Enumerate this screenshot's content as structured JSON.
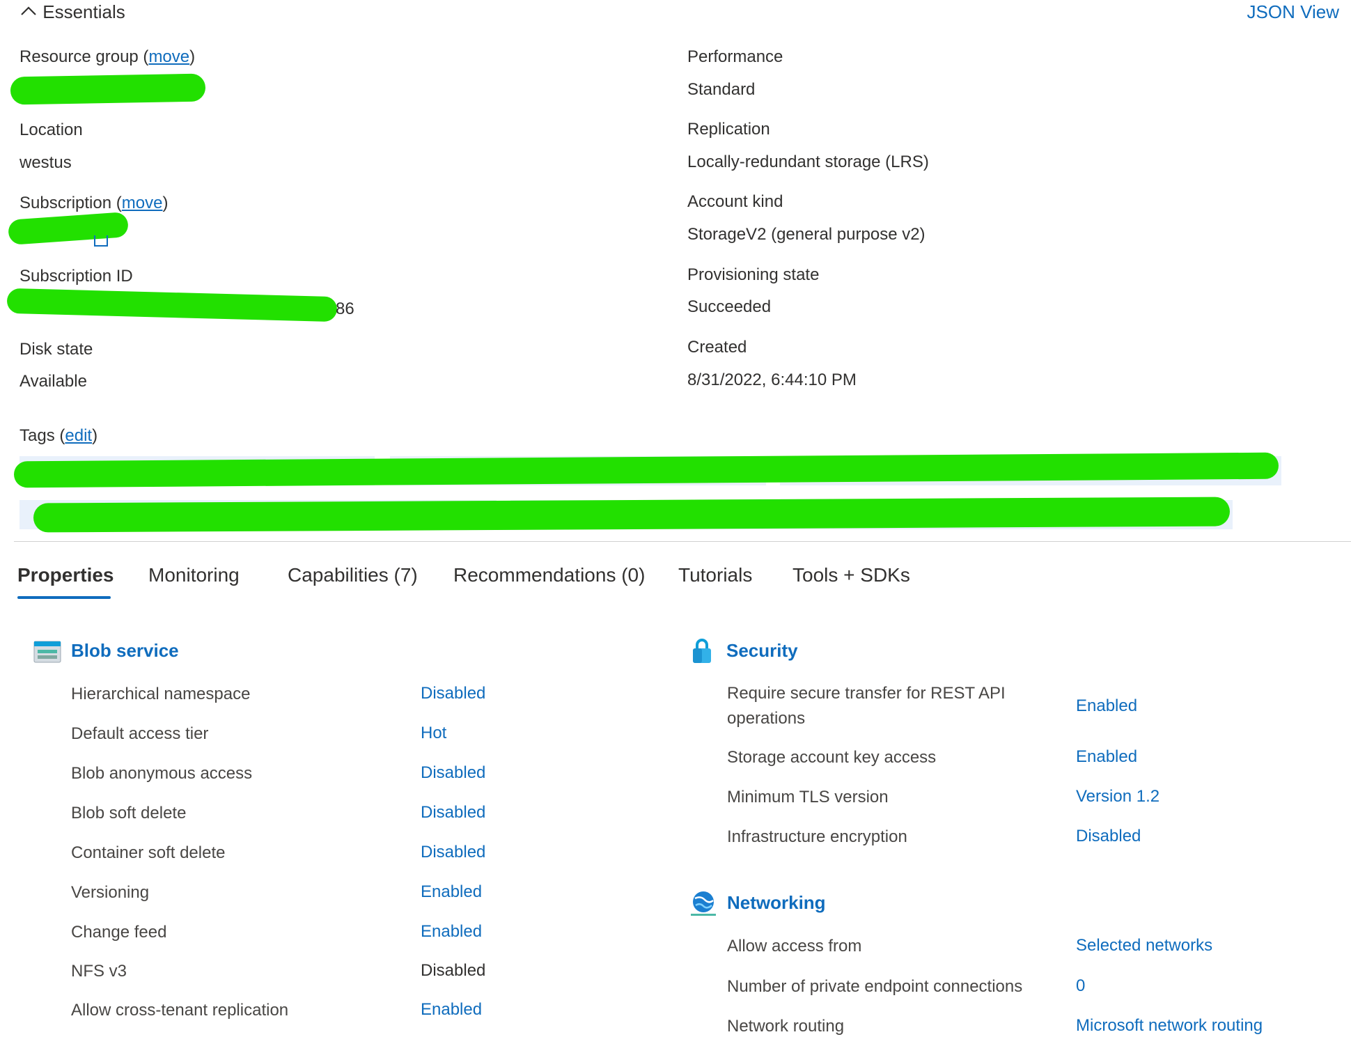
{
  "essentials": {
    "title": "Essentials",
    "json_view": "JSON View",
    "left": {
      "resource_group_label": "Resource group",
      "location_label": "Location",
      "location_value": "westus",
      "subscription_label": "Subscription",
      "subscription_id_label": "Subscription ID",
      "subscription_id_tail": "86",
      "disk_state_label": "Disk state",
      "disk_state_value": "Available",
      "move": "move"
    },
    "right": {
      "performance_label": "Performance",
      "performance_value": "Standard",
      "replication_label": "Replication",
      "replication_value": "Locally-redundant storage (LRS)",
      "account_kind_label": "Account kind",
      "account_kind_value": "StorageV2 (general purpose v2)",
      "provisioning_label": "Provisioning state",
      "provisioning_value": "Succeeded",
      "created_label": "Created",
      "created_value": "8/31/2022, 6:44:10 PM"
    },
    "tags_label": "Tags",
    "tags_edit": "edit"
  },
  "tabs": [
    {
      "label": "Properties",
      "active": true
    },
    {
      "label": "Monitoring"
    },
    {
      "label": "Capabilities (7)"
    },
    {
      "label": "Recommendations (0)"
    },
    {
      "label": "Tutorials"
    },
    {
      "label": "Tools + SDKs"
    }
  ],
  "blob_service": {
    "title": "Blob service",
    "rows": [
      {
        "label": "Hierarchical namespace",
        "value": "Disabled"
      },
      {
        "label": "Default access tier",
        "value": "Hot"
      },
      {
        "label": "Blob anonymous access",
        "value": "Disabled"
      },
      {
        "label": "Blob soft delete",
        "value": "Disabled"
      },
      {
        "label": "Container soft delete",
        "value": "Disabled"
      },
      {
        "label": "Versioning",
        "value": "Enabled"
      },
      {
        "label": "Change feed",
        "value": "Enabled"
      },
      {
        "label": "NFS v3",
        "value": "Disabled"
      },
      {
        "label": "Allow cross-tenant replication",
        "value": "Enabled"
      }
    ]
  },
  "security": {
    "title": "Security",
    "row1_label_a": "Require secure transfer for REST API",
    "row1_label_b": "operations",
    "row1_value": "Enabled",
    "rows": [
      {
        "label": "Storage account key access",
        "value": "Enabled"
      },
      {
        "label": "Minimum TLS version",
        "value": "Version 1.2"
      },
      {
        "label": "Infrastructure encryption",
        "value": "Disabled"
      }
    ]
  },
  "networking": {
    "title": "Networking",
    "rows": [
      {
        "label": "Allow access from",
        "value": "Selected networks"
      },
      {
        "label": "Number of private endpoint connections",
        "value": "0"
      },
      {
        "label": "Network routing",
        "value": "Microsoft network routing"
      }
    ]
  },
  "colors": {
    "accent": "#0f6cbd",
    "redaction": "#22e000",
    "tag_bg": "#e9f1fb"
  }
}
